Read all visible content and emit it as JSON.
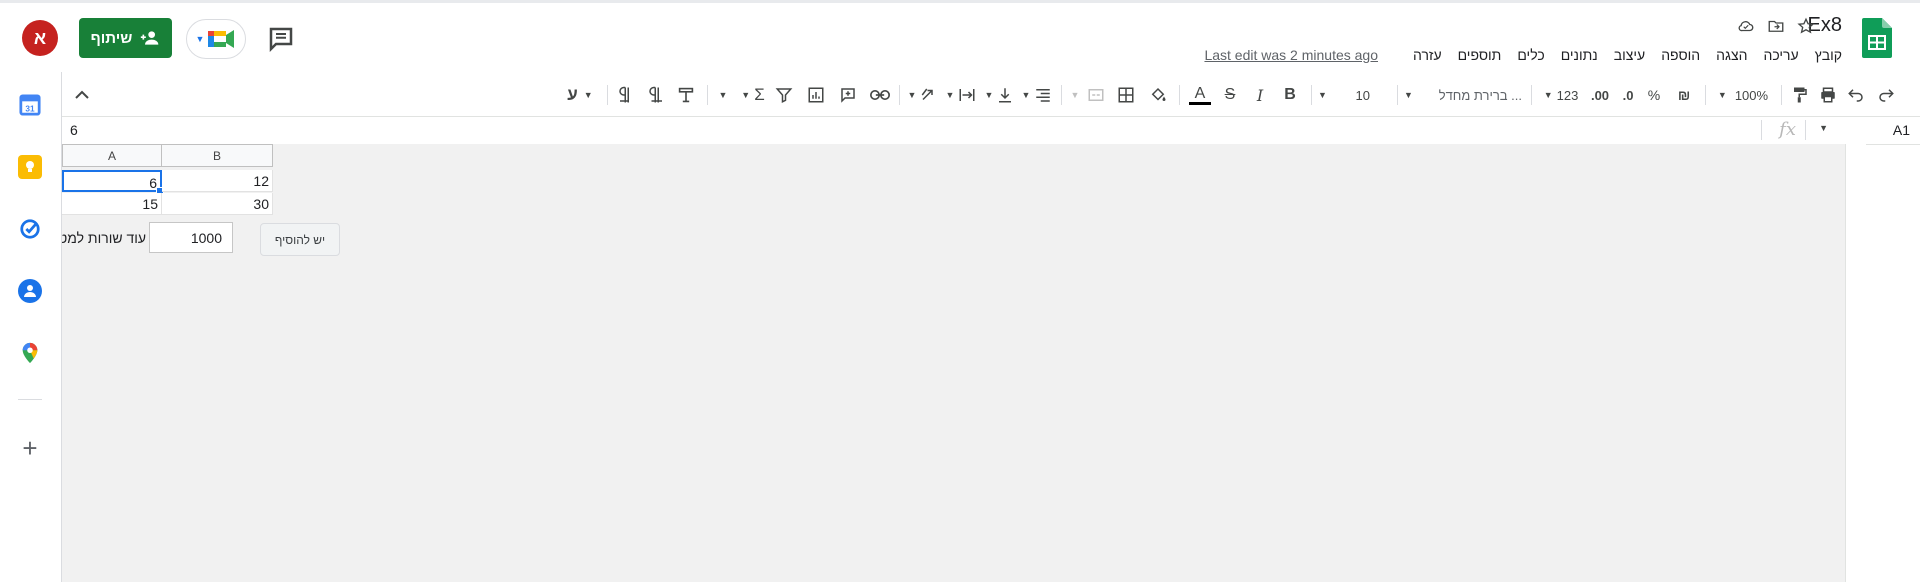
{
  "doc": {
    "title": "Ex8",
    "last_edit": "Last edit was 2 minutes ago"
  },
  "menu": [
    "קובץ",
    "עריכה",
    "הצגה",
    "הוספה",
    "עיצוב",
    "נתונים",
    "כלים",
    "תוספים",
    "עזרה"
  ],
  "header": {
    "share_label": "שיתוף",
    "avatar_letter": "א"
  },
  "toolbar": {
    "zoom": "100%",
    "currency": "₪",
    "percent": "%",
    "dec_decrease": ".0",
    "dec_increase": ".00",
    "format_more": "123",
    "font": "ברירת מחדל ...",
    "font_size": "10",
    "bold": "B",
    "italic": "I",
    "strike": "S",
    "text_color": "A",
    "input_tools": "ע"
  },
  "formula_bar": {
    "cell_ref": "A1",
    "fx": "fx",
    "value": "6"
  },
  "grid": {
    "columns": [
      "A",
      "B"
    ],
    "rows": [
      {
        "A": "6",
        "B": "12"
      },
      {
        "A": "15",
        "B": "30"
      }
    ]
  },
  "add_rows": {
    "button_label": "יש להוסיף",
    "count": "1000",
    "label": "עוד שורות למטה"
  },
  "colors": {
    "share_green": "#188038",
    "avatar_red": "#c5221f",
    "selection_blue": "#1a73e8"
  },
  "side_icons": [
    "calendar-icon",
    "keep-icon",
    "tasks-icon",
    "contacts-icon",
    "maps-icon"
  ]
}
